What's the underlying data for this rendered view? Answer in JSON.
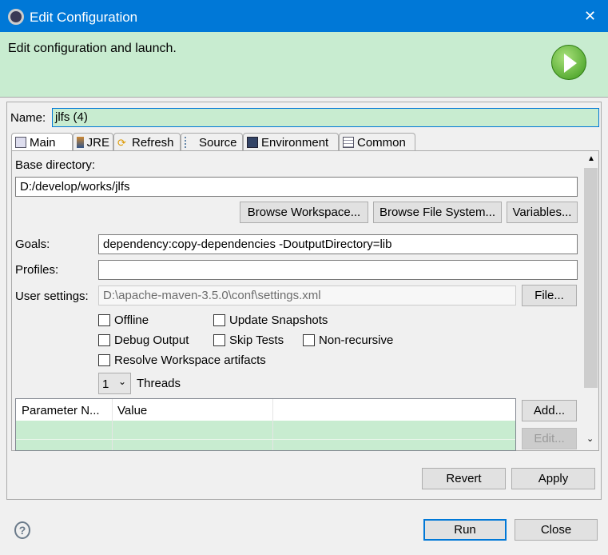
{
  "window": {
    "title": "Edit Configuration",
    "close_glyph": "✕"
  },
  "banner": {
    "message": "Edit configuration and launch.",
    "icon": "run-icon"
  },
  "name": {
    "label": "Name:",
    "value": "jlfs (4)"
  },
  "tabs": [
    {
      "label": "Main",
      "active": true
    },
    {
      "label": "JRE"
    },
    {
      "label": "Refresh"
    },
    {
      "label": "Source"
    },
    {
      "label": "Environment"
    },
    {
      "label": "Common"
    }
  ],
  "main": {
    "base_dir_label": "Base directory:",
    "base_dir_value": "D:/develop/works/jlfs",
    "browse_workspace": "Browse Workspace...",
    "browse_fs": "Browse File System...",
    "variables": "Variables...",
    "goals_label": "Goals:",
    "goals_value": "dependency:copy-dependencies -DoutputDirectory=lib",
    "profiles_label": "Profiles:",
    "profiles_value": "",
    "user_settings_label": "User settings:",
    "user_settings_value": "D:\\apache-maven-3.5.0\\conf\\settings.xml",
    "file_button": "File...",
    "checkboxes": {
      "offline": "Offline",
      "update_snapshots": "Update Snapshots",
      "debug_output": "Debug Output",
      "skip_tests": "Skip Tests",
      "non_recursive": "Non-recursive",
      "resolve_workspace": "Resolve Workspace artifacts"
    },
    "threads_value": "1",
    "threads_label": "Threads",
    "table": {
      "columns": [
        "Parameter N...",
        "Value",
        ""
      ],
      "rows": []
    },
    "add_button": "Add...",
    "edit_button": "Edit..."
  },
  "footer": {
    "revert": "Revert",
    "apply": "Apply",
    "run": "Run",
    "close": "Close",
    "help_glyph": "?"
  },
  "colors": {
    "titlebar": "#0078d7",
    "banner": "#c8ecd0",
    "focus": "#0078d7"
  }
}
